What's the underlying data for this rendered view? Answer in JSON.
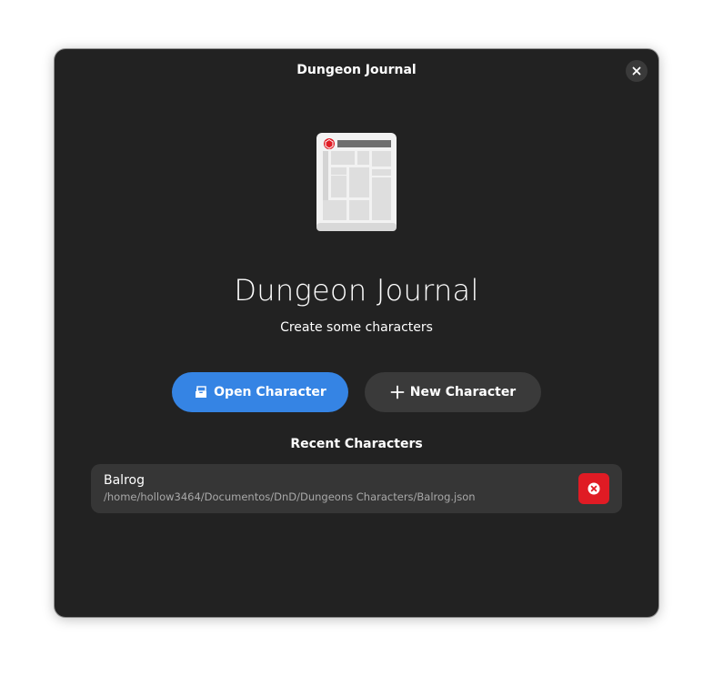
{
  "window": {
    "title": "Dungeon Journal"
  },
  "hero": {
    "icon": "character-sheet-icon",
    "app_name": "Dungeon Journal",
    "subtitle": "Create some characters"
  },
  "actions": {
    "open_label": "Open Character",
    "open_icon": "document-open-icon",
    "new_label": "New Character",
    "new_icon": "plus-icon"
  },
  "recent": {
    "heading": "Recent Characters",
    "items": [
      {
        "name": "Balrog",
        "path": "/home/hollow3464/Documentos/DnD/Dungeons Characters/Balrog.json"
      }
    ]
  },
  "colors": {
    "window_bg": "#222222",
    "accent": "#3584e4",
    "secondary_button": "#3a3a3a",
    "row_bg": "#363636",
    "destructive": "#e01b24"
  }
}
